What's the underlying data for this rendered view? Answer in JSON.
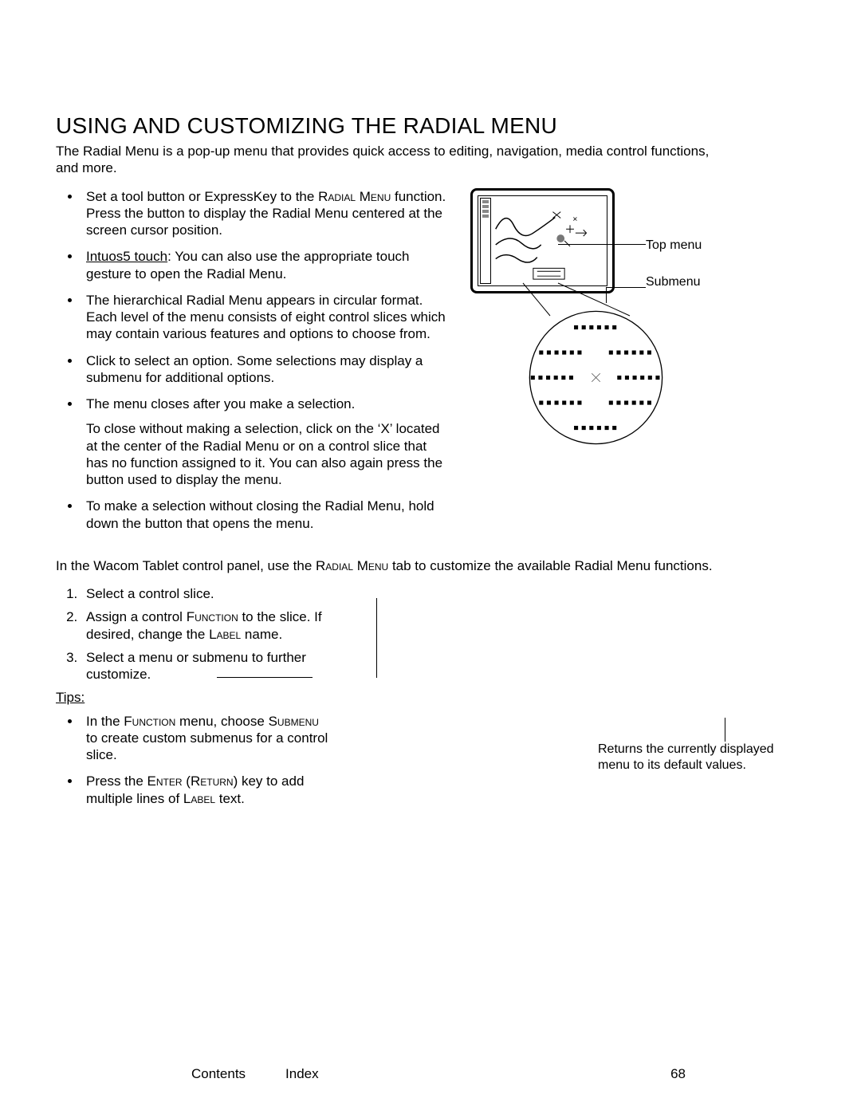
{
  "heading": "USING AND CUSTOMIZING THE RADIAL MENU",
  "intro": "The Radial Menu is a pop-up menu that provides quick access to editing, navigation, media control functions, and more.",
  "bullets": [
    {
      "pre": "Set a tool button or ExpressKey to the ",
      "sc": "Radial Menu",
      "post": " function.  Press the button to display the Radial Menu centered at the screen cursor position."
    },
    {
      "link": "Intuos5 touch",
      "post": ": You can also use the appropriate touch gesture to open the Radial Menu."
    },
    {
      "text": "The hierarchical Radial Menu appears in circular format.  Each level of the menu consists of eight control slices which may contain various features and options to choose from."
    },
    {
      "text": "Click to select an option.  Some selections may display a submenu for additional options."
    },
    {
      "text": "The menu closes after you make a selection.",
      "sub": "To close without making a selection, click on the ‘X’ located at the center of the Radial Menu or on a control slice that has no function assigned to it.  You can also again press the button used to display the menu."
    },
    {
      "text": "To make a selection without closing the Radial Menu, hold down the button that opens the menu."
    }
  ],
  "diagram": {
    "top": "Top menu",
    "sub": "Submenu",
    "dots": "▪▪▪▪▪▪"
  },
  "mid_pre": "In the Wacom Tablet control panel, use the ",
  "mid_sc": "Radial Menu",
  "mid_post": " tab to customize the available Radial Menu functions.",
  "steps": [
    "Select a control slice.",
    {
      "pre": "Assign a control ",
      "sc1": "Function",
      "mid": " to the slice.  If desired, change the ",
      "sc2": "Label",
      "post": " name."
    },
    "Select a menu or submenu to further customize."
  ],
  "tips_label": "Tips",
  "tips": [
    {
      "pre": "In the ",
      "sc1": "Function",
      "mid": " menu, choose ",
      "sc2": "Submenu",
      "post": " to create custom submenus for a control slice."
    },
    {
      "pre": "Press the ",
      "sc1": "Enter",
      "paren": " (",
      "sc2": "Return",
      "paren2": ") ",
      "post": "key to add multiple lines of ",
      "sc3": "Label",
      "post2": " text."
    }
  ],
  "returns": "Returns the currently displayed menu to its default values.",
  "footer": {
    "contents": "Contents",
    "index": "Index",
    "page": "68"
  }
}
